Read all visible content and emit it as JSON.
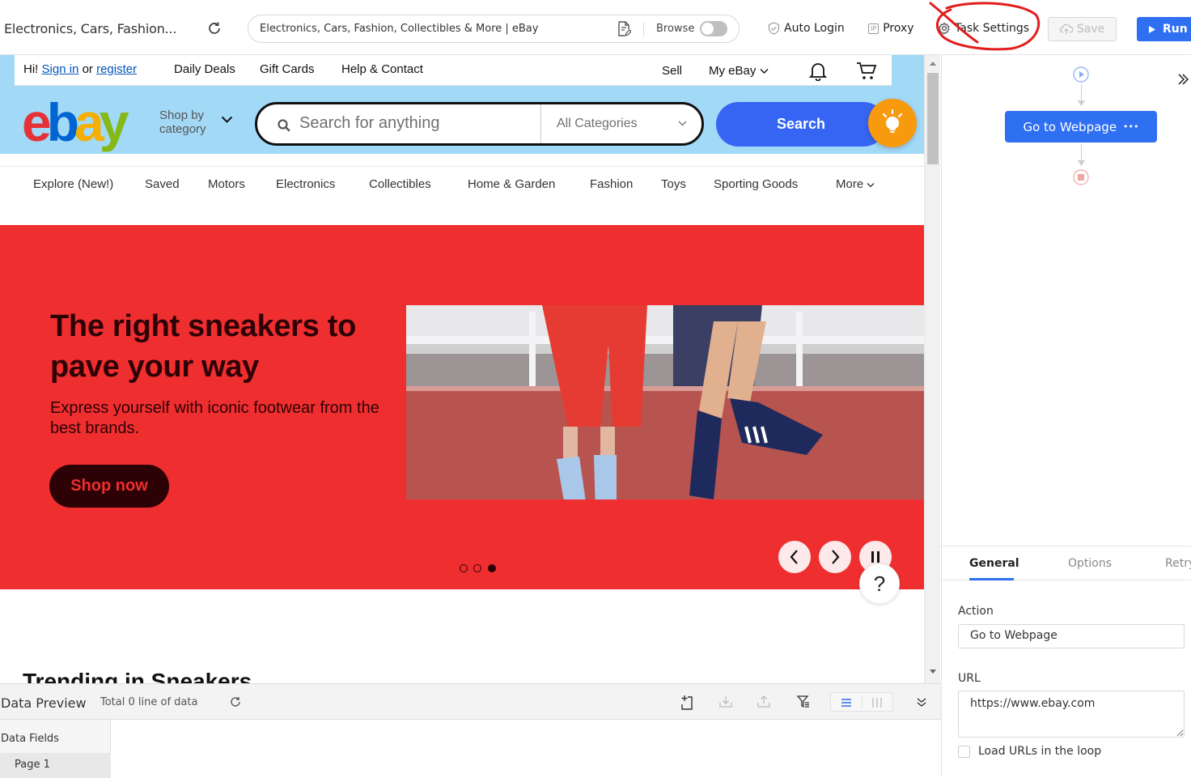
{
  "toolbar": {
    "page_tab_title": "Electronics, Cars, Fashion...",
    "url_bar_text": "Electronics, Cars, Fashion, Collectibles & More | eBay",
    "browse_label": "Browse",
    "browse_toggle_on": false,
    "auto_login_label": "Auto Login",
    "proxy_label": "Proxy",
    "proxy_icon_text": "IP",
    "task_settings_label": "Task Settings",
    "save_label": "Save",
    "run_label": "Run",
    "accent_color": "#2f6ff1",
    "annotation_color": "#e11d1d"
  },
  "ebay": {
    "topnav": {
      "greeting": "Hi!",
      "sign_in": "Sign in",
      "or": "or",
      "register": "register",
      "links": [
        "Daily Deals",
        "Gift Cards",
        "Help & Contact"
      ],
      "sell": "Sell",
      "my_ebay": "My eBay"
    },
    "logo": {
      "e": "e",
      "b": "b",
      "a": "a",
      "y": "y"
    },
    "shop_by_category": "Shop by category",
    "search_placeholder": "Search for anything",
    "category_select": "All Categories",
    "search_button": "Search",
    "category_nav": [
      "Explore (New!)",
      "Saved",
      "Motors",
      "Electronics",
      "Collectibles",
      "Home & Garden",
      "Fashion",
      "Toys",
      "Sporting Goods",
      "More"
    ],
    "hero": {
      "title": "The right sneakers to pave your way",
      "subtitle": "Express yourself with iconic footwear from the best brands.",
      "cta": "Shop now",
      "background_color": "#ef2e2f",
      "slide_count": 3,
      "active_slide": 3
    },
    "help_button": "?",
    "trending_heading": "Trending in Sneakers"
  },
  "data_preview": {
    "title": "Data Preview",
    "total": "Total 0 line of data",
    "fields_label": "Data Fields",
    "page_label": "Page 1"
  },
  "workflow": {
    "node_label": "Go to Webpage",
    "node_more": "•••"
  },
  "properties": {
    "tabs": [
      "General",
      "Options",
      "Retry"
    ],
    "active_tab": "General",
    "action_label": "Action",
    "action_value": "Go to Webpage",
    "url_label": "URL",
    "url_value": "https://www.ebay.com",
    "loop_label": "Load URLs in the loop",
    "loop_checked": false
  }
}
